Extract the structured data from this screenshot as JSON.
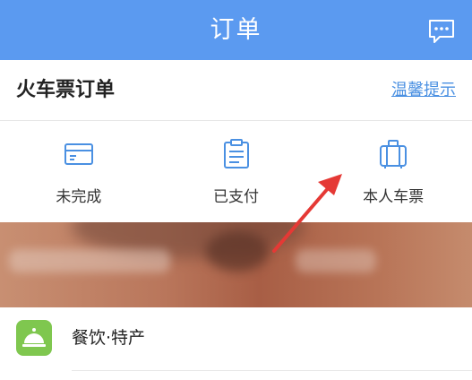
{
  "header": {
    "title": "订单",
    "message_icon": "chat-bubble-icon"
  },
  "section": {
    "title": "火车票订单",
    "link": "温馨提示"
  },
  "tiles": [
    {
      "label": "未完成",
      "icon": "ticket-card-icon"
    },
    {
      "label": "已支付",
      "icon": "clipboard-list-icon"
    },
    {
      "label": "本人车票",
      "icon": "luggage-icon"
    }
  ],
  "service": {
    "label": "餐饮·特产",
    "icon": "service-bell-icon"
  },
  "colors": {
    "header": "#5b9af0",
    "accent": "#4a90e2",
    "service_icon_bg": "#7fc74f",
    "annotation_arrow": "#e53935"
  }
}
